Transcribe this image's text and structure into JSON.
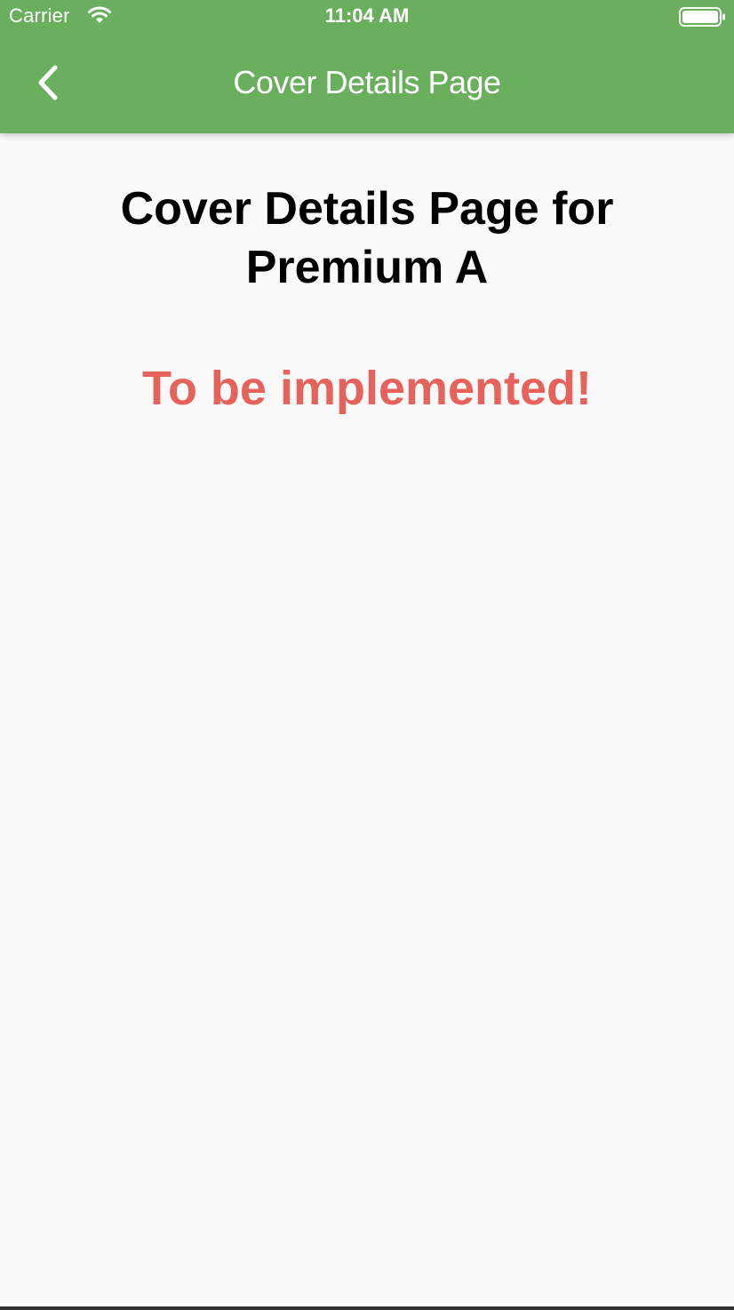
{
  "status_bar": {
    "carrier": "Carrier",
    "time": "11:04 AM",
    "wifi_icon": "wifi-icon",
    "battery_icon": "battery-full-icon"
  },
  "app_bar": {
    "title": "Cover Details Page",
    "back_icon": "chevron-left-icon",
    "background_color": "#6aaf5e"
  },
  "main": {
    "heading": "Cover Details Page for Premium A",
    "notice": "To be implemented!",
    "notice_color": "#e8625c"
  }
}
